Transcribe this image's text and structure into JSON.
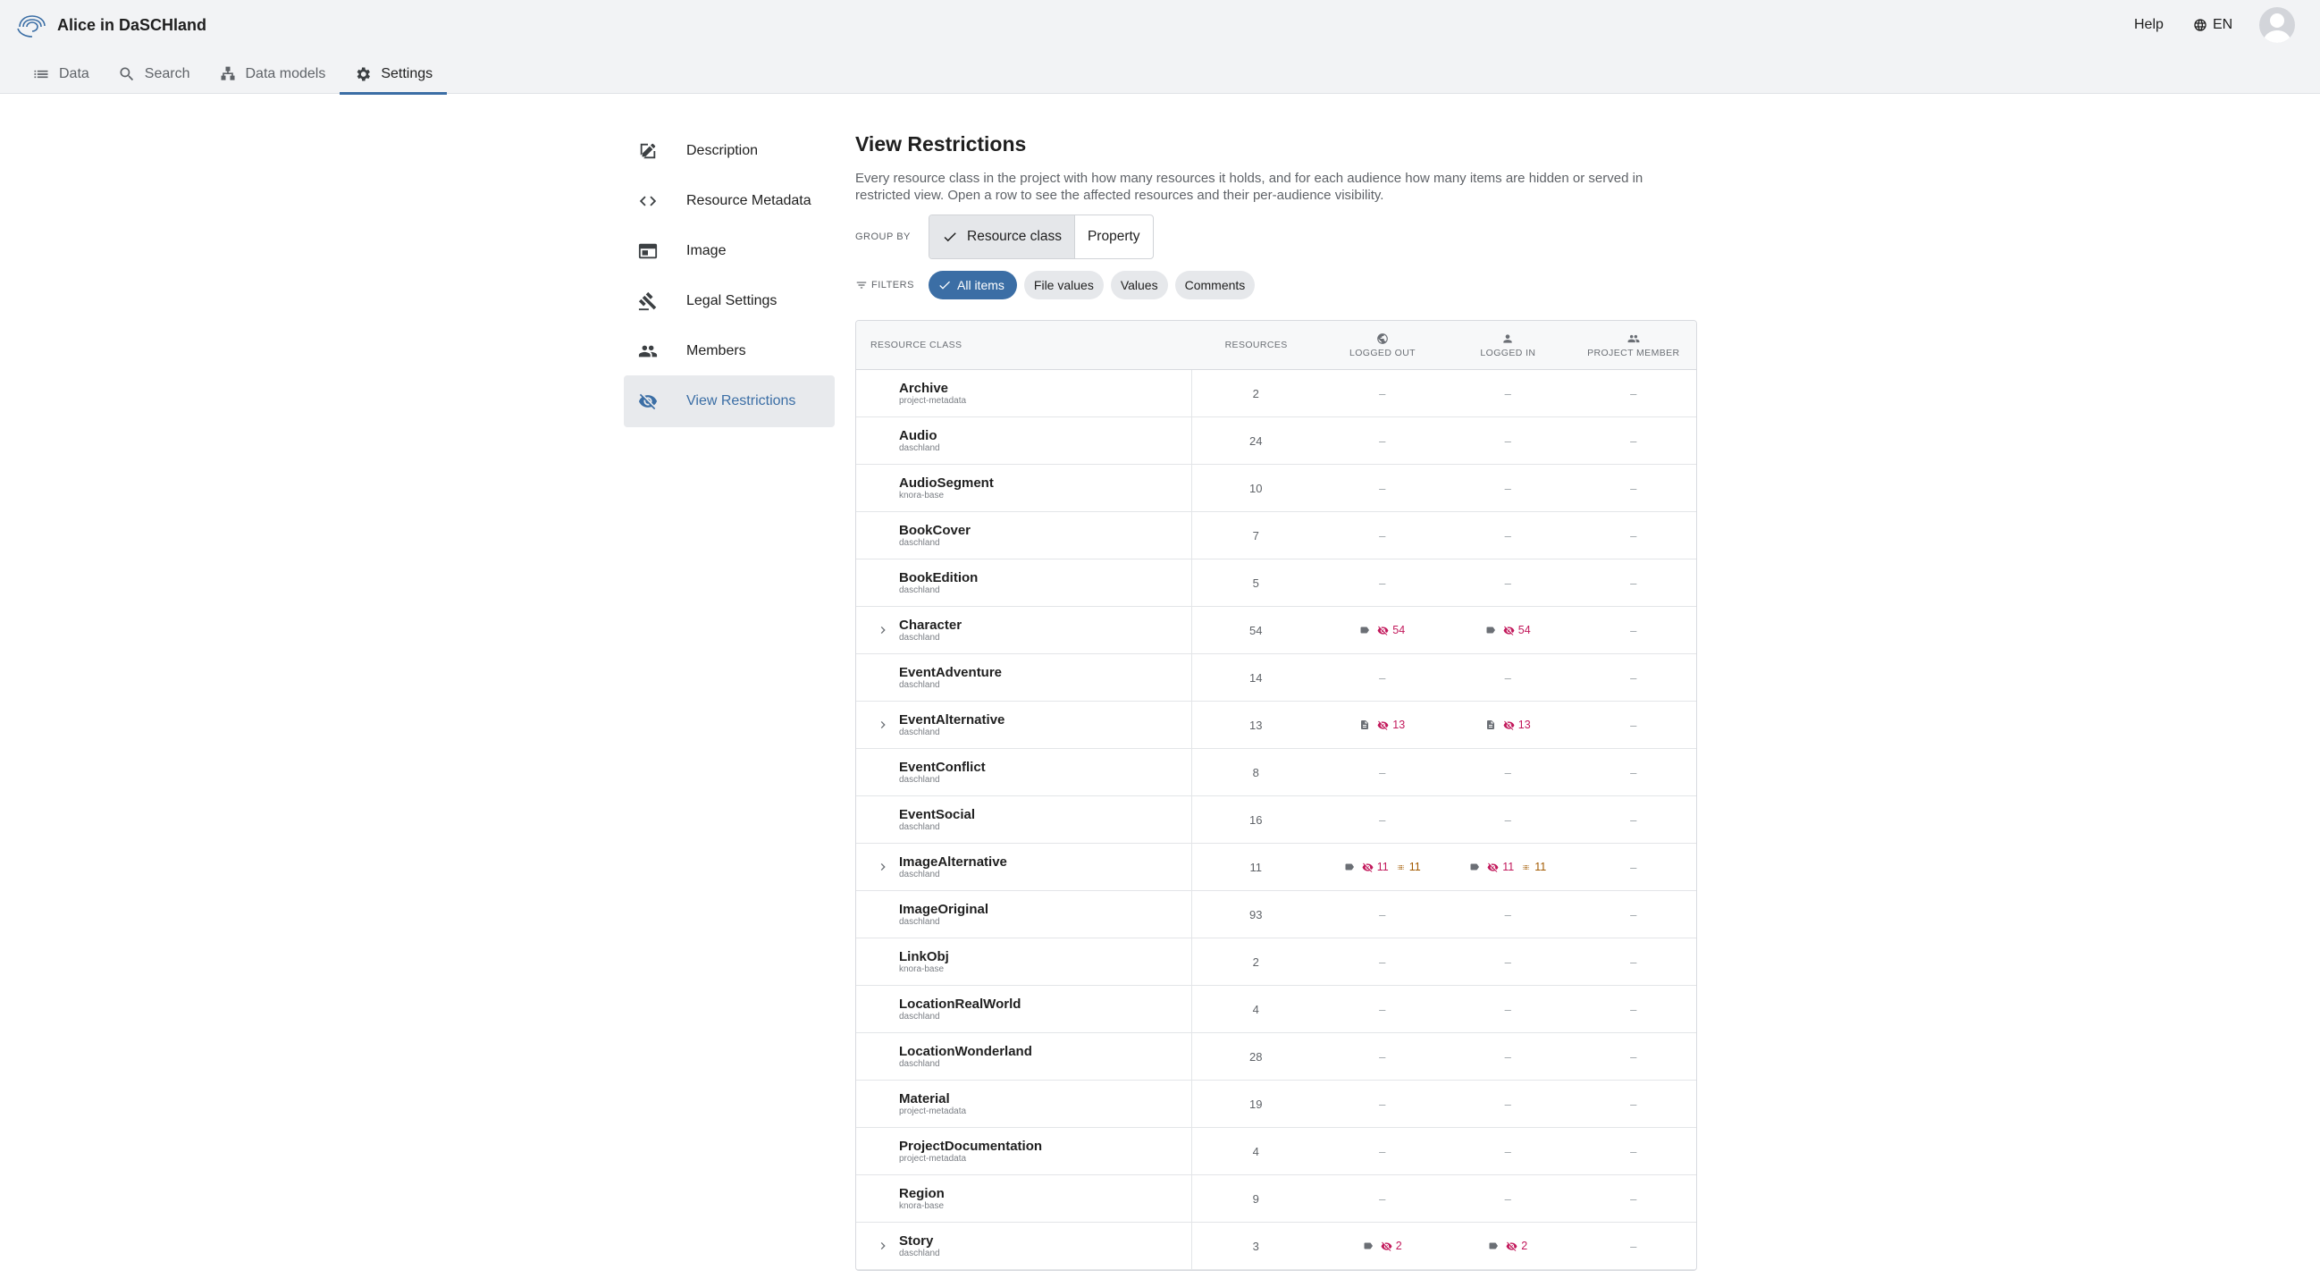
{
  "app": {
    "title": "Alice in DaSCHland",
    "help": "Help",
    "lang": "EN"
  },
  "nav": [
    {
      "label": "Data",
      "icon": "list-icon"
    },
    {
      "label": "Search",
      "icon": "search-icon"
    },
    {
      "label": "Data models",
      "icon": "data-models-icon"
    },
    {
      "label": "Settings",
      "icon": "gear-icon",
      "active": true
    }
  ],
  "sidebar": [
    {
      "label": "Description",
      "icon": "edit-icon"
    },
    {
      "label": "Resource Metadata",
      "icon": "code-icon"
    },
    {
      "label": "Image",
      "icon": "image-icon"
    },
    {
      "label": "Legal Settings",
      "icon": "gavel-icon"
    },
    {
      "label": "Members",
      "icon": "people-icon"
    },
    {
      "label": "View Restrictions",
      "icon": "eye-off-icon",
      "active": true
    }
  ],
  "main": {
    "title": "View Restrictions",
    "description": "Every resource class in the project with how many resources it holds, and for each audience how many items are hidden or served in restricted view. Open a row to see the affected resources and their per-audience visibility.",
    "group_by_label": "GROUP BY",
    "group_by_options": [
      "Resource class",
      "Property"
    ],
    "group_by_selected": "Resource class",
    "filters_label": "FILTERS",
    "filters": [
      "All items",
      "File values",
      "Values",
      "Comments"
    ],
    "filter_selected": "All items"
  },
  "table": {
    "headers": {
      "resource_class": "RESOURCE CLASS",
      "resources": "RESOURCES",
      "logged_out": "LOGGED OUT",
      "logged_in": "LOGGED IN",
      "project_member": "PROJECT MEMBER"
    },
    "dash": "–",
    "rows": [
      {
        "name": "Archive",
        "ontology": "project-metadata",
        "resources": "2"
      },
      {
        "name": "Audio",
        "ontology": "daschland",
        "resources": "24"
      },
      {
        "name": "AudioSegment",
        "ontology": "knora-base",
        "resources": "10"
      },
      {
        "name": "BookCover",
        "ontology": "daschland",
        "resources": "7"
      },
      {
        "name": "BookEdition",
        "ontology": "daschland",
        "resources": "5"
      },
      {
        "name": "Character",
        "ontology": "daschland",
        "resources": "54",
        "expandable": true,
        "logged_out": [
          {
            "kind": "tag",
            "icon": "label-icon"
          },
          {
            "kind": "hidden",
            "icon": "eye-off-icon",
            "count": "54"
          }
        ],
        "logged_in": [
          {
            "kind": "tag",
            "icon": "label-icon"
          },
          {
            "kind": "hidden",
            "icon": "eye-off-icon",
            "count": "54"
          }
        ]
      },
      {
        "name": "EventAdventure",
        "ontology": "daschland",
        "resources": "14"
      },
      {
        "name": "EventAlternative",
        "ontology": "daschland",
        "resources": "13",
        "expandable": true,
        "logged_out": [
          {
            "kind": "tag",
            "icon": "document-icon"
          },
          {
            "kind": "hidden",
            "icon": "eye-off-icon",
            "count": "13"
          }
        ],
        "logged_in": [
          {
            "kind": "tag",
            "icon": "document-icon"
          },
          {
            "kind": "hidden",
            "icon": "eye-off-icon",
            "count": "13"
          }
        ]
      },
      {
        "name": "EventConflict",
        "ontology": "daschland",
        "resources": "8"
      },
      {
        "name": "EventSocial",
        "ontology": "daschland",
        "resources": "16"
      },
      {
        "name": "ImageAlternative",
        "ontology": "daschland",
        "resources": "11",
        "expandable": true,
        "logged_out": [
          {
            "kind": "tag",
            "icon": "label-icon"
          },
          {
            "kind": "hidden",
            "icon": "eye-off-icon",
            "count": "11"
          },
          {
            "kind": "restricted",
            "icon": "blur-icon",
            "count": "11"
          }
        ],
        "logged_in": [
          {
            "kind": "tag",
            "icon": "label-icon"
          },
          {
            "kind": "hidden",
            "icon": "eye-off-icon",
            "count": "11"
          },
          {
            "kind": "restricted",
            "icon": "blur-icon",
            "count": "11"
          }
        ]
      },
      {
        "name": "ImageOriginal",
        "ontology": "daschland",
        "resources": "93"
      },
      {
        "name": "LinkObj",
        "ontology": "knora-base",
        "resources": "2"
      },
      {
        "name": "LocationRealWorld",
        "ontology": "daschland",
        "resources": "4"
      },
      {
        "name": "LocationWonderland",
        "ontology": "daschland",
        "resources": "28"
      },
      {
        "name": "Material",
        "ontology": "project-metadata",
        "resources": "19"
      },
      {
        "name": "ProjectDocumentation",
        "ontology": "project-metadata",
        "resources": "4"
      },
      {
        "name": "Region",
        "ontology": "knora-base",
        "resources": "9"
      },
      {
        "name": "Story",
        "ontology": "daschland",
        "resources": "3",
        "expandable": true,
        "logged_out": [
          {
            "kind": "tag",
            "icon": "label-icon"
          },
          {
            "kind": "hidden",
            "icon": "eye-off-icon",
            "count": "2"
          }
        ],
        "logged_in": [
          {
            "kind": "tag",
            "icon": "label-icon"
          },
          {
            "kind": "hidden",
            "icon": "eye-off-icon",
            "count": "2"
          }
        ]
      }
    ]
  },
  "colors": {
    "accent": "#3b6ea5",
    "hidden": "#c2185b",
    "restricted": "#a35a00"
  }
}
